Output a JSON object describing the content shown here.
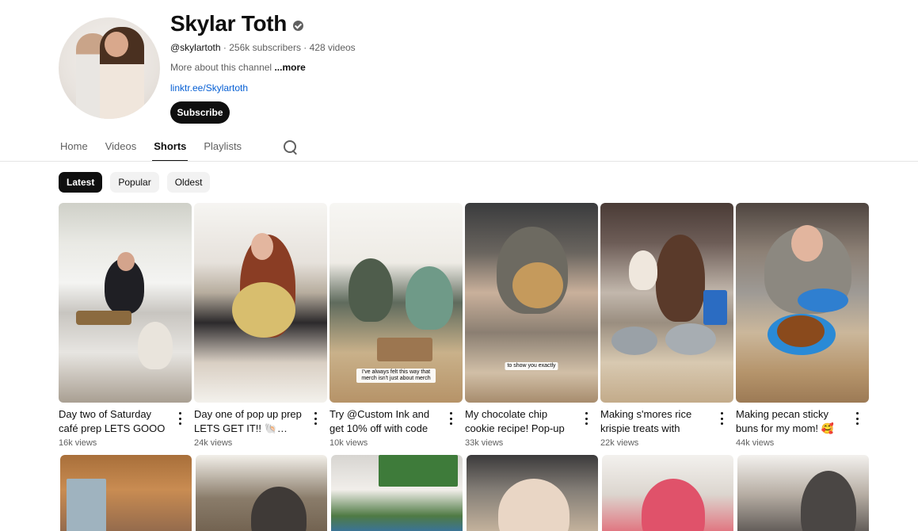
{
  "channel": {
    "name": "Skylar Toth",
    "handle": "@skylartoth",
    "subscribers": "256k subscribers",
    "videos": "428 videos",
    "about": "More about this channel",
    "more_label": "...more",
    "link": "linktr.ee/Skylartoth",
    "subscribe_label": "Subscribe"
  },
  "tabs": [
    {
      "label": "Home"
    },
    {
      "label": "Videos"
    },
    {
      "label": "Shorts"
    },
    {
      "label": "Playlists"
    }
  ],
  "active_tab": "Shorts",
  "chips": [
    {
      "label": "Latest"
    },
    {
      "label": "Popular"
    },
    {
      "label": "Oldest"
    }
  ],
  "shorts": [
    {
      "title": "Day two of Saturday café prep LETS GOOO",
      "views": "16k views",
      "overlay": ""
    },
    {
      "title": "Day one of pop up prep LETS GET IT!! 🐚 #baking",
      "views": "24k views",
      "overlay": ""
    },
    {
      "title": "Try @Custom Ink and get 10% off with code",
      "views": "10k views",
      "overlay": "I've always felt this way that merch isn't just about merch"
    },
    {
      "title": "My chocolate chip cookie recipe! Pop-up",
      "views": "33k views",
      "overlay": "to show you exactly"
    },
    {
      "title": "Making s'mores rice krispie treats with",
      "views": "22k views",
      "overlay": ""
    },
    {
      "title": "Making pecan sticky buns for my mom! 🥰",
      "views": "44k views",
      "overlay": ""
    }
  ]
}
